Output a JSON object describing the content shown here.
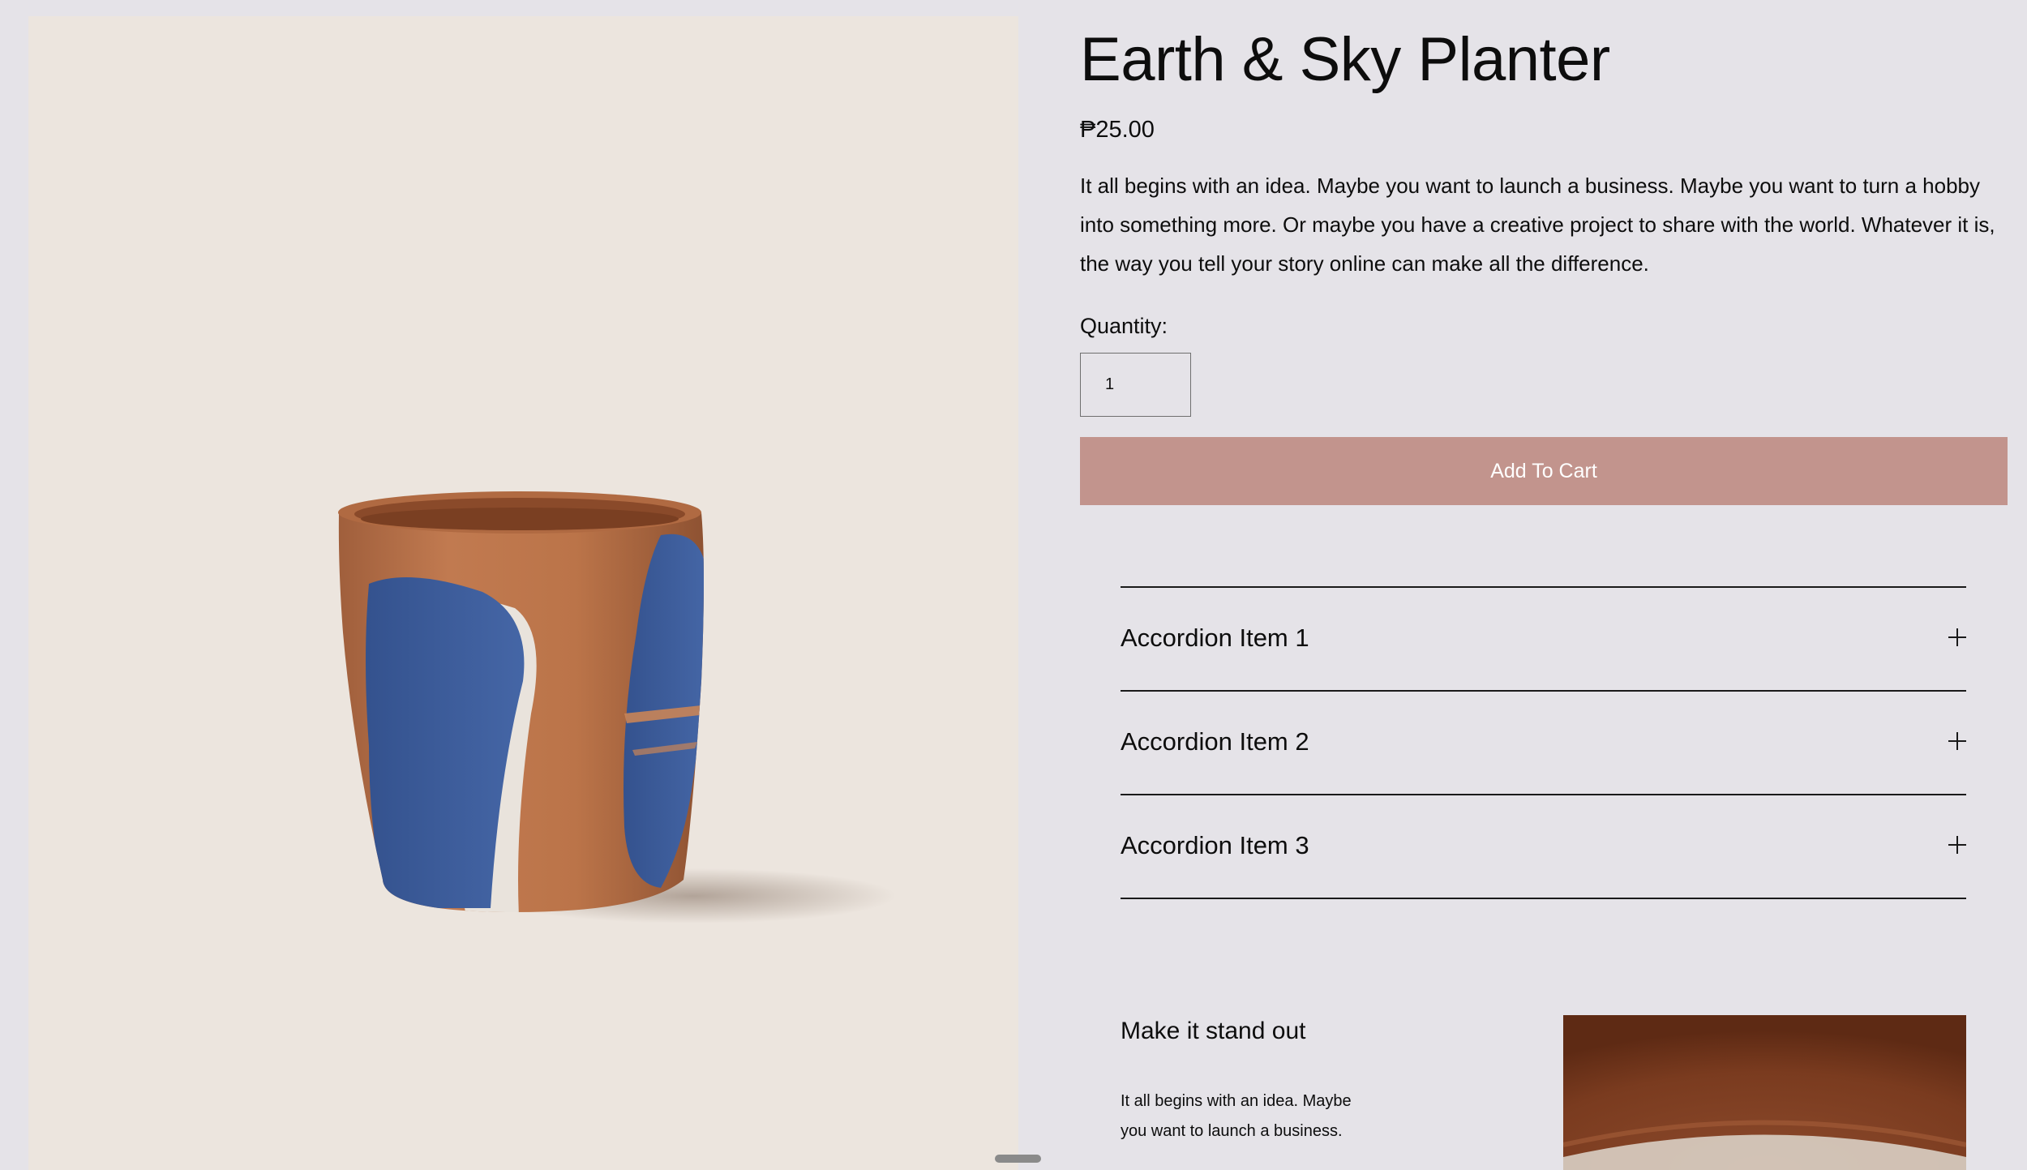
{
  "product": {
    "title": "Earth & Sky Planter",
    "price": "₱25.00",
    "description": "It all begins with an idea. Maybe you want to launch a business. Maybe you want to turn a hobby into something more. Or maybe you have a creative project to share with the world. Whatever it is, the way you tell your story online can make all the difference."
  },
  "quantity": {
    "label": "Quantity:",
    "value": "1"
  },
  "cart": {
    "button_label": "Add To Cart"
  },
  "accordion": {
    "items": [
      {
        "label": "Accordion Item 1",
        "icon": "plus-icon"
      },
      {
        "label": "Accordion Item 2",
        "icon": "plus-icon"
      },
      {
        "label": "Accordion Item 3",
        "icon": "plus-icon"
      }
    ]
  },
  "feature": {
    "heading": "Make it stand out",
    "text": "It all begins with an idea. Maybe you want to launch a business."
  },
  "colors": {
    "page_background": "#e5e3e8",
    "image_background": "#ece5de",
    "button_background": "#c2948d",
    "button_text": "#ffffff",
    "terracotta": "#b56f48",
    "glaze_blue": "#3a5a96"
  }
}
